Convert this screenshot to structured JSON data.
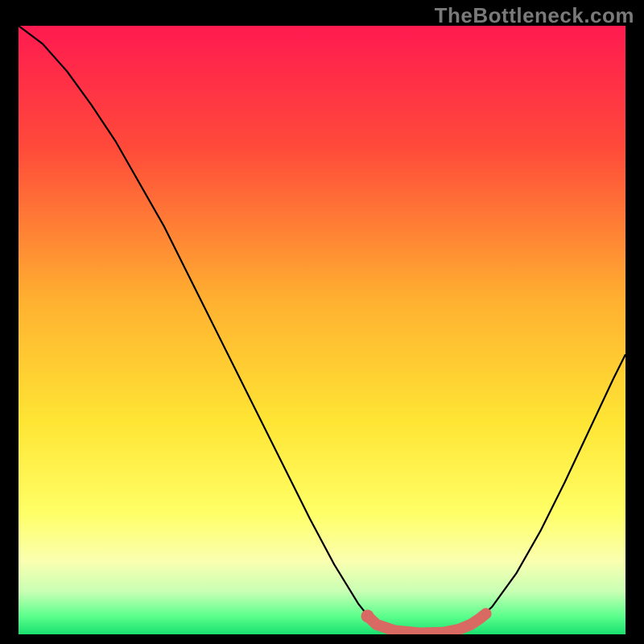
{
  "watermark": "TheBottleneck.com",
  "chart_data": {
    "type": "line",
    "title": "",
    "xlabel": "",
    "ylabel": "",
    "xlim": [
      0,
      100
    ],
    "ylim": [
      0,
      100
    ],
    "background_gradient": {
      "stops": [
        {
          "offset": 0,
          "color": "#ff1a50"
        },
        {
          "offset": 20,
          "color": "#ff4a3a"
        },
        {
          "offset": 45,
          "color": "#ffb030"
        },
        {
          "offset": 65,
          "color": "#ffe534"
        },
        {
          "offset": 80,
          "color": "#ffff66"
        },
        {
          "offset": 88,
          "color": "#faffb0"
        },
        {
          "offset": 93,
          "color": "#c8ffb4"
        },
        {
          "offset": 97,
          "color": "#5cff8c"
        },
        {
          "offset": 100,
          "color": "#18e070"
        }
      ]
    },
    "series": [
      {
        "name": "bottleneck-curve",
        "type": "line",
        "color": "#000000",
        "width": 2.2,
        "points": [
          {
            "x": 0,
            "y": 100
          },
          {
            "x": 4,
            "y": 97
          },
          {
            "x": 8,
            "y": 92.5
          },
          {
            "x": 12,
            "y": 87
          },
          {
            "x": 16,
            "y": 81
          },
          {
            "x": 20,
            "y": 74
          },
          {
            "x": 24,
            "y": 67
          },
          {
            "x": 28,
            "y": 59
          },
          {
            "x": 32,
            "y": 51
          },
          {
            "x": 36,
            "y": 43
          },
          {
            "x": 40,
            "y": 35
          },
          {
            "x": 44,
            "y": 27
          },
          {
            "x": 48,
            "y": 19
          },
          {
            "x": 52,
            "y": 11.5
          },
          {
            "x": 56,
            "y": 5
          },
          {
            "x": 58,
            "y": 2.5
          },
          {
            "x": 60,
            "y": 1
          },
          {
            "x": 64,
            "y": 0.2
          },
          {
            "x": 68,
            "y": 0.2
          },
          {
            "x": 72,
            "y": 0.6
          },
          {
            "x": 75,
            "y": 1.8
          },
          {
            "x": 78,
            "y": 4.5
          },
          {
            "x": 82,
            "y": 10
          },
          {
            "x": 86,
            "y": 17
          },
          {
            "x": 90,
            "y": 25
          },
          {
            "x": 94,
            "y": 33.5
          },
          {
            "x": 98,
            "y": 42
          },
          {
            "x": 100,
            "y": 46
          }
        ]
      },
      {
        "name": "optimal-band",
        "type": "line",
        "color": "#d96a63",
        "width": 14,
        "linecap": "round",
        "points": [
          {
            "x": 57.5,
            "y": 3.0
          },
          {
            "x": 59,
            "y": 1.6
          },
          {
            "x": 62,
            "y": 0.6
          },
          {
            "x": 66,
            "y": 0.2
          },
          {
            "x": 70,
            "y": 0.3
          },
          {
            "x": 72.5,
            "y": 0.8
          },
          {
            "x": 74.5,
            "y": 1.6
          },
          {
            "x": 76,
            "y": 2.6
          },
          {
            "x": 77,
            "y": 3.4
          }
        ]
      }
    ],
    "optimal_marker": {
      "x": 57.5,
      "y": 3.0,
      "r": 8,
      "color": "#d96a63"
    }
  }
}
